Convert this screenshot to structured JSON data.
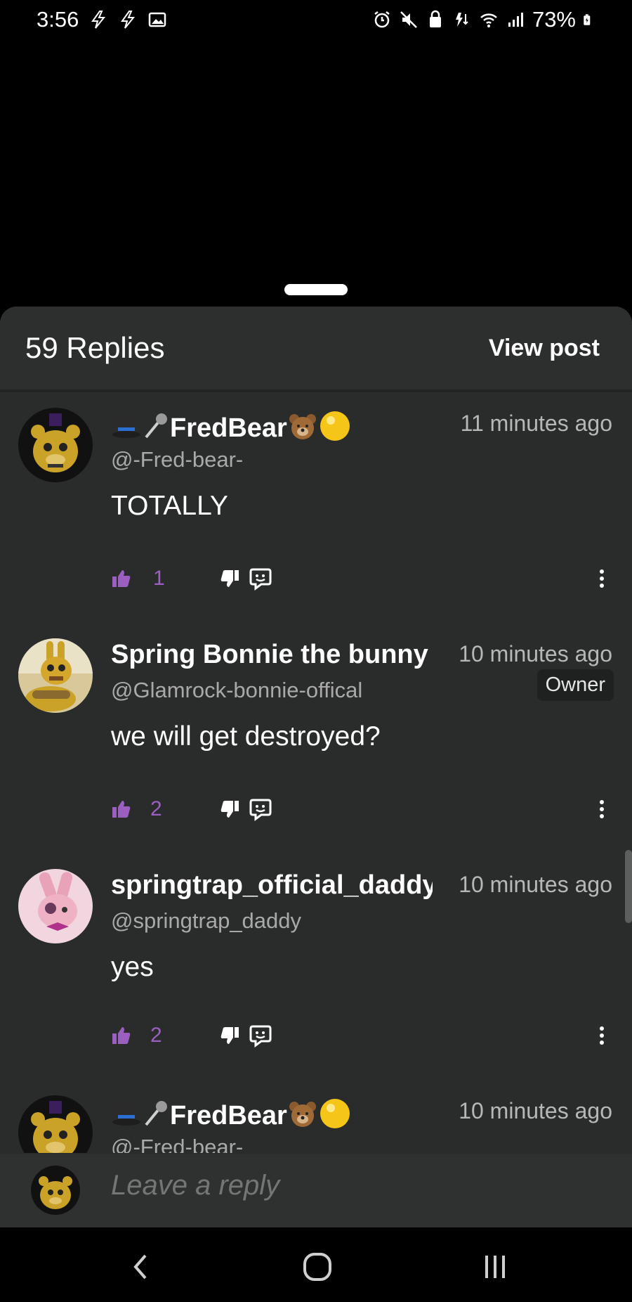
{
  "status_bar": {
    "time": "3:56",
    "battery": "73%",
    "icons": [
      "flash-icon",
      "flash-icon",
      "image-icon",
      "alarm-icon",
      "mute-icon",
      "lock-icon",
      "data-icon",
      "wifi-icon",
      "signal-icon",
      "battery-icon"
    ]
  },
  "header": {
    "replies": "59 Replies",
    "view_post": "View post"
  },
  "comments": [
    {
      "name": "FredBear",
      "handle": "@-Fred-bear-",
      "time": "11 minutes ago",
      "text": "TOTALLY",
      "likes": "1",
      "owner": ""
    },
    {
      "name": "Spring Bonnie the bunny",
      "handle": "@Glamrock-bonnie-offical",
      "time": "10 minutes ago",
      "text": "we will get destroyed?",
      "likes": "2",
      "owner": "Owner"
    },
    {
      "name": "springtrap_official_daddy",
      "handle": "@springtrap_daddy",
      "time": "10 minutes ago",
      "text": "yes",
      "likes": "2",
      "owner": ""
    },
    {
      "name": "FredBear",
      "handle": "@-Fred-bear-",
      "time": "10 minutes ago",
      "text": "",
      "likes": "",
      "owner": ""
    }
  ],
  "reply_bar": {
    "placeholder": "Leave a reply"
  },
  "colors": {
    "accent": "#9b5fc0",
    "sheet": "#2a2c2c"
  }
}
